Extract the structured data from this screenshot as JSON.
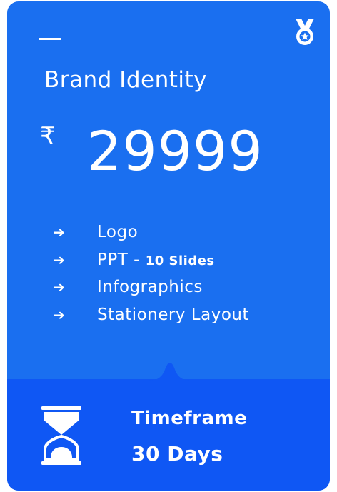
{
  "card": {
    "title": "Brand Identity",
    "currency_symbol": "₹",
    "price": "29999",
    "features": [
      {
        "arrow": "➔",
        "label": "Logo",
        "suffix": ""
      },
      {
        "arrow": "➔",
        "label": "PPT - ",
        "suffix": "10 Slides"
      },
      {
        "arrow": "➔",
        "label": "Infographics",
        "suffix": ""
      },
      {
        "arrow": "➔",
        "label": "Stationery Layout",
        "suffix": ""
      }
    ],
    "timeframe": {
      "label": "Timeframe",
      "value": "30 Days"
    }
  },
  "icons": {
    "dash": "minus-line-icon",
    "medal": "medal-icon",
    "hourglass": "hourglass-icon"
  },
  "colors": {
    "card_bg": "#1a6ff0",
    "footer_bg": "#0f57f4",
    "text": "#ffffff"
  }
}
